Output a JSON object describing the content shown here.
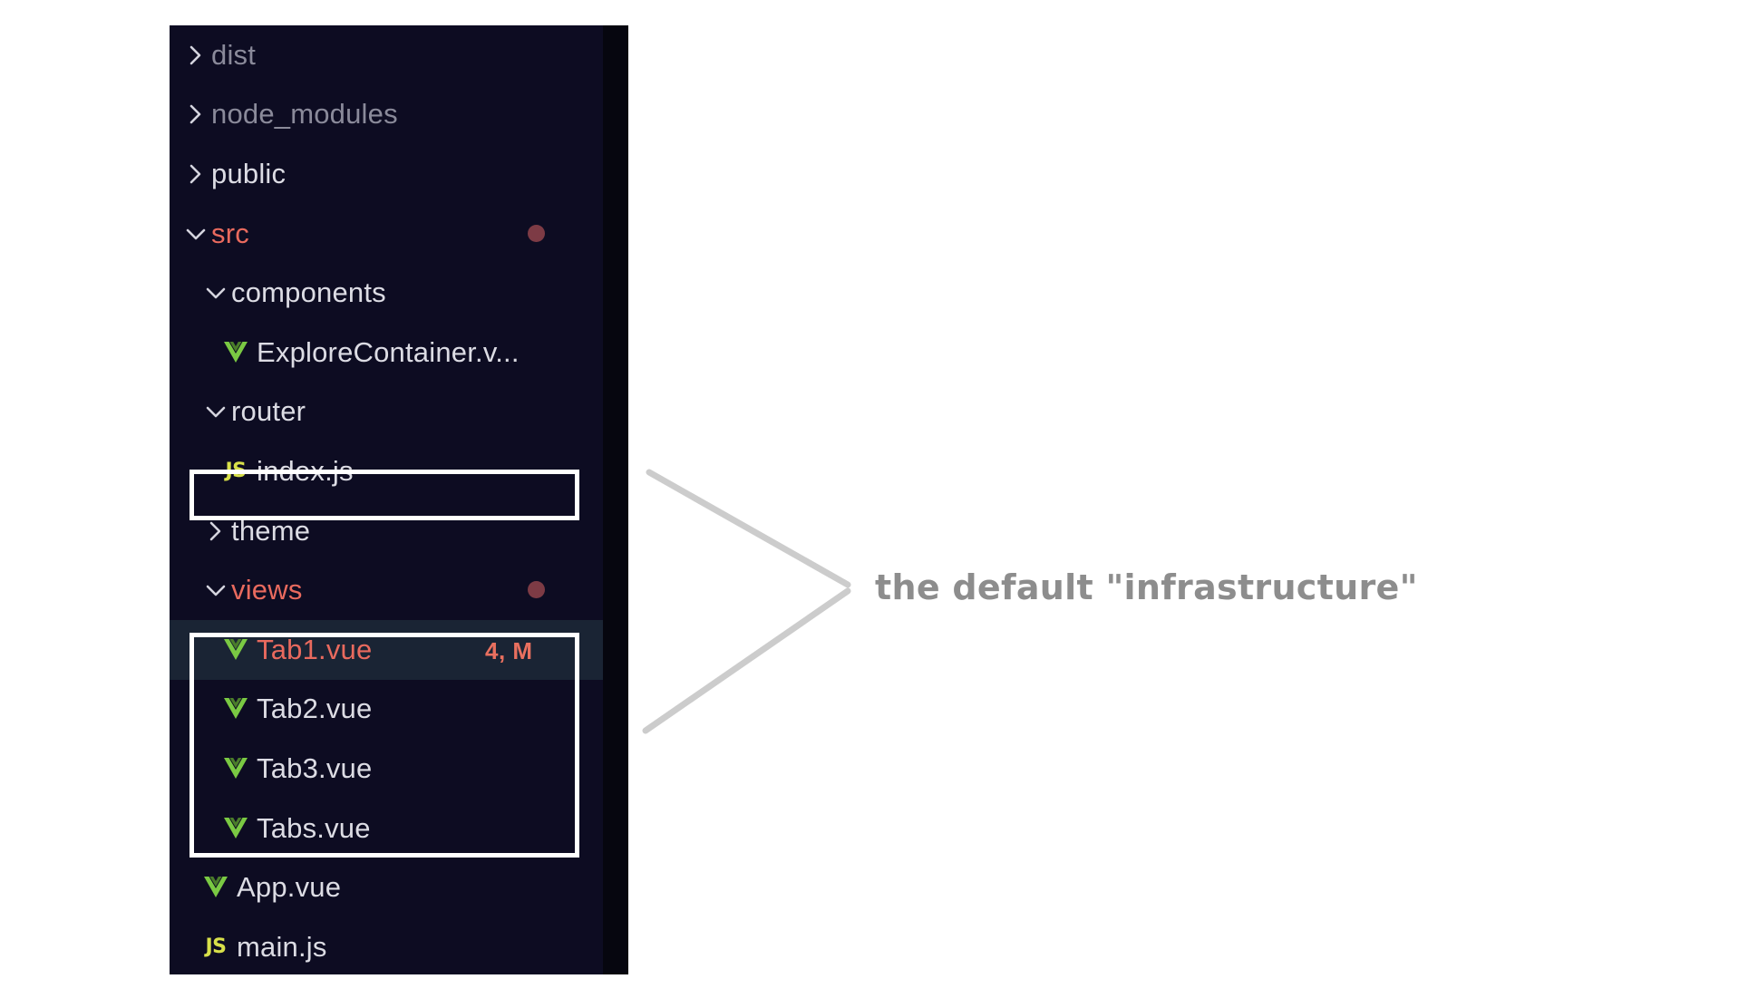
{
  "explorer": {
    "panel_bg": "#0d0c22",
    "selection_bg": "#1a2434",
    "modified_color": "#e96a5e",
    "vue_icon_color": "#7ac943",
    "js_icon_color": "#d8e04a",
    "tree": [
      {
        "label": "dist",
        "kind": "folder",
        "state": "collapsed",
        "indent": 0,
        "dim": true,
        "modified": false,
        "badge": ""
      },
      {
        "label": "node_modules",
        "kind": "folder",
        "state": "collapsed",
        "indent": 0,
        "dim": true,
        "modified": false,
        "badge": ""
      },
      {
        "label": "public",
        "kind": "folder",
        "state": "collapsed",
        "indent": 0,
        "dim": false,
        "modified": false,
        "badge": ""
      },
      {
        "label": "src",
        "kind": "folder",
        "state": "expanded",
        "indent": 0,
        "dim": false,
        "modified": true,
        "badge": "dot"
      },
      {
        "label": "components",
        "kind": "folder",
        "state": "expanded",
        "indent": 1,
        "dim": false,
        "modified": false,
        "badge": ""
      },
      {
        "label": "ExploreContainer.v...",
        "kind": "vue",
        "state": "file",
        "indent": 2,
        "dim": false,
        "modified": false,
        "badge": ""
      },
      {
        "label": "router",
        "kind": "folder",
        "state": "expanded",
        "indent": 1,
        "dim": false,
        "modified": false,
        "badge": ""
      },
      {
        "label": "index.js",
        "kind": "js",
        "state": "file",
        "indent": 2,
        "dim": false,
        "modified": false,
        "badge": ""
      },
      {
        "label": "theme",
        "kind": "folder",
        "state": "collapsed",
        "indent": 1,
        "dim": false,
        "modified": false,
        "badge": ""
      },
      {
        "label": "views",
        "kind": "folder",
        "state": "expanded",
        "indent": 1,
        "dim": false,
        "modified": true,
        "badge": "dot"
      },
      {
        "label": "Tab1.vue",
        "kind": "vue",
        "state": "file",
        "indent": 2,
        "dim": false,
        "modified": true,
        "badge": "4, M",
        "selected": true
      },
      {
        "label": "Tab2.vue",
        "kind": "vue",
        "state": "file",
        "indent": 2,
        "dim": false,
        "modified": false,
        "badge": ""
      },
      {
        "label": "Tab3.vue",
        "kind": "vue",
        "state": "file",
        "indent": 2,
        "dim": false,
        "modified": false,
        "badge": ""
      },
      {
        "label": "Tabs.vue",
        "kind": "vue",
        "state": "file",
        "indent": 2,
        "dim": false,
        "modified": false,
        "badge": ""
      },
      {
        "label": "App.vue",
        "kind": "vue",
        "state": "file",
        "indent": 1,
        "dim": false,
        "modified": false,
        "badge": ""
      },
      {
        "label": "main.js",
        "kind": "js",
        "state": "file",
        "indent": 1,
        "dim": false,
        "modified": false,
        "badge": ""
      }
    ]
  },
  "annotation": {
    "text": "the default \"infrastructure\"",
    "color": "#8d8d8d",
    "line_color": "#cccccc"
  },
  "callouts": [
    {
      "name": "index-js-callout",
      "target": "index.js"
    },
    {
      "name": "views-files-callout",
      "target": "Tab1.vue / Tab2.vue / Tab3.vue / Tabs.vue"
    }
  ]
}
